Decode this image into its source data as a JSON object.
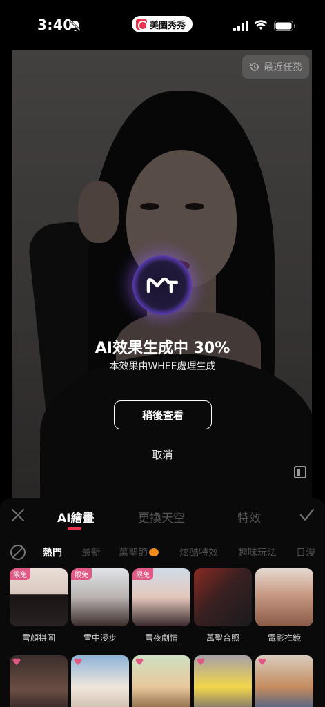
{
  "status_bar": {
    "time": "3:40",
    "app_name": "美圖秀秀"
  },
  "photo": {
    "recent_tasks_label": "最近任務"
  },
  "progress": {
    "title": "AI效果生成中 30%",
    "percent": 30,
    "subtitle": "本效果由WHEE處理生成",
    "view_later_label": "稍後查看",
    "cancel_label": "取消"
  },
  "bottom_panel": {
    "main_tabs": [
      {
        "label": "AI繪畫",
        "active": true
      },
      {
        "label": "更換天空",
        "active": false
      },
      {
        "label": "特效",
        "active": false
      }
    ],
    "category_tabs": [
      {
        "label": "熱門",
        "active": true
      },
      {
        "label": "最新",
        "active": false
      },
      {
        "label": "萬聖節",
        "active": false
      },
      {
        "label": "炫酷特效",
        "active": false
      },
      {
        "label": "趣味玩法",
        "active": false
      },
      {
        "label": "日漫",
        "active": false
      }
    ],
    "effects_row1": [
      {
        "label": "雪顏拼圖",
        "badge": "限免"
      },
      {
        "label": "雪中漫步",
        "badge": "限免"
      },
      {
        "label": "雪夜劇情",
        "badge": "限免"
      },
      {
        "label": "萬聖合照",
        "badge": ""
      },
      {
        "label": "電影推鏡",
        "badge": ""
      }
    ],
    "effects_row2": [
      {
        "label": "",
        "badge": "heart"
      },
      {
        "label": "",
        "badge": "heart"
      },
      {
        "label": "",
        "badge": "heart"
      },
      {
        "label": "",
        "badge": "heart"
      },
      {
        "label": "",
        "badge": "heart"
      }
    ]
  },
  "colors": {
    "accent": "#e8344e",
    "badge": "#e15a86",
    "glow": "#9b6bff"
  }
}
